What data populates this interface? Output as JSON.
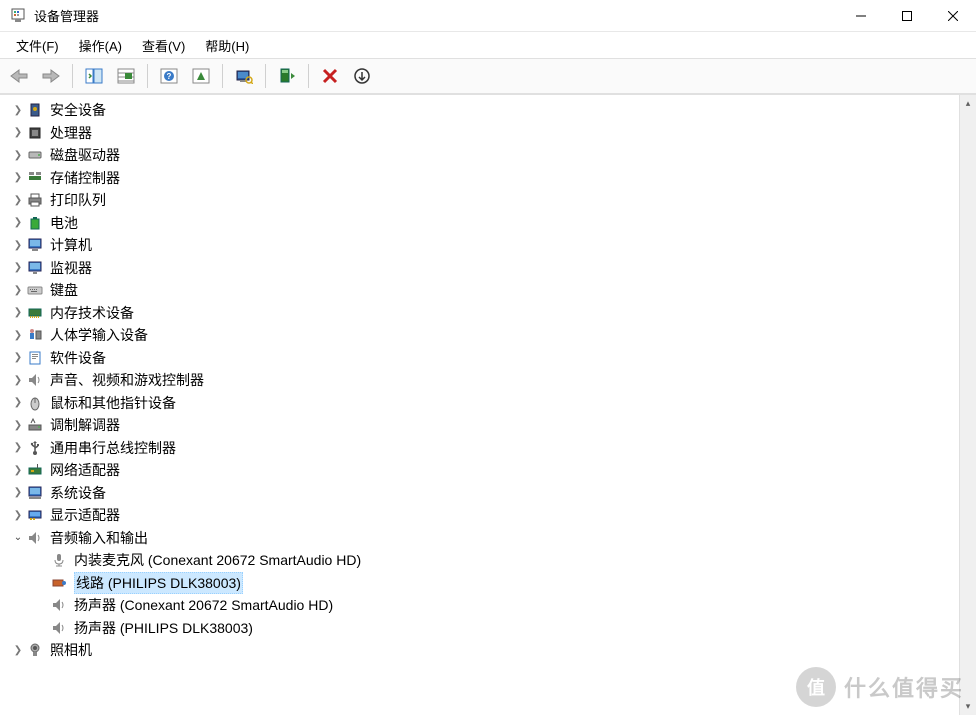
{
  "window": {
    "title": "设备管理器"
  },
  "menu": {
    "file": "文件(F)",
    "action": "操作(A)",
    "view": "查看(V)",
    "help": "帮助(H)"
  },
  "tree": {
    "security": "安全设备",
    "cpu": "处理器",
    "disk": "磁盘驱动器",
    "storage": "存储控制器",
    "print": "打印队列",
    "battery": "电池",
    "computer": "计算机",
    "monitor": "监视器",
    "keyboard": "键盘",
    "memory": "内存技术设备",
    "hid": "人体学输入设备",
    "software": "软件设备",
    "sound": "声音、视频和游戏控制器",
    "mouse": "鼠标和其他指针设备",
    "modem": "调制解调器",
    "usb": "通用串行总线控制器",
    "network": "网络适配器",
    "system": "系统设备",
    "display": "显示适配器",
    "audio": "音频输入和输出",
    "audio_children": {
      "mic": "内装麦克风 (Conexant 20672 SmartAudio HD)",
      "line": "线路 (PHILIPS DLK38003)",
      "spk1": "扬声器 (Conexant 20672 SmartAudio HD)",
      "spk2": "扬声器 (PHILIPS DLK38003)"
    },
    "camera": "照相机"
  },
  "watermark": {
    "badge": "值",
    "text": "什么值得买"
  }
}
